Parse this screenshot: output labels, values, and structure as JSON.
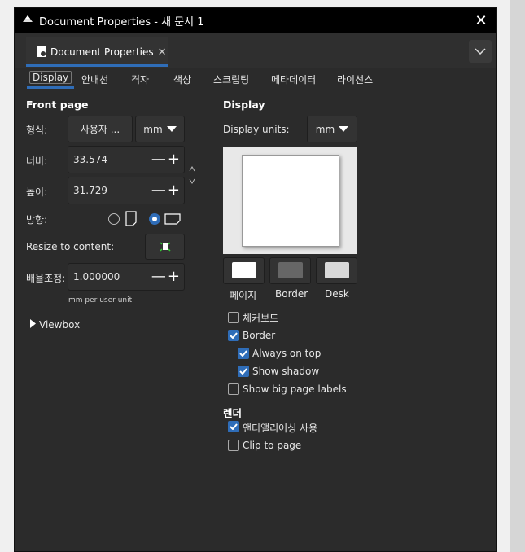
{
  "window": {
    "title": "Document Properties - 새 문서 1"
  },
  "dock": {
    "tab_label": "Document Properties",
    "tab_close": "✕"
  },
  "tabs": [
    "Display",
    "안내선",
    "격자",
    "색상",
    "스크립팅",
    "메타데이터",
    "라이선스"
  ],
  "front_page": {
    "heading": "Front page",
    "format_label": "형식:",
    "format_value": "사용자 ...",
    "format_unit": "mm",
    "width_label": "너비:",
    "width_value": "33.574",
    "height_label": "높이:",
    "height_value": "31.729",
    "orientation_label": "방향:",
    "resize_label": "Resize to content:",
    "scale_label": "배율조정:",
    "scale_value": "1.000000",
    "scale_hint": "mm per user unit",
    "viewbox_label": "Viewbox"
  },
  "display": {
    "heading": "Display",
    "units_label": "Display units:",
    "units_value": "mm",
    "swatches": [
      {
        "label": "페이지",
        "color": "#ffffff"
      },
      {
        "label": "Border",
        "color": "#666666"
      },
      {
        "label": "Desk",
        "color": "#d9d9d9"
      }
    ],
    "checkboxes": [
      {
        "label": "체커보드",
        "checked": false
      },
      {
        "label": "Border",
        "checked": true
      },
      {
        "label": "Always on top",
        "checked": true
      },
      {
        "label": "Show shadow",
        "checked": true
      },
      {
        "label": "Show big page labels",
        "checked": false
      }
    ],
    "render_heading": "렌더",
    "render_checkboxes": [
      {
        "label": "앤티앨리어싱 사용",
        "checked": true
      },
      {
        "label": "Clip to page",
        "checked": false
      }
    ]
  },
  "colors": {
    "accent": "#2f6db8",
    "panel": "#2b2b2b",
    "titlebar": "#000000"
  }
}
